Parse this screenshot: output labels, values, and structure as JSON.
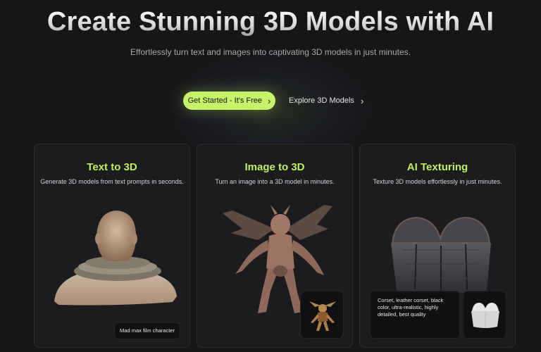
{
  "hero": {
    "title": "Create Stunning 3D Models with AI",
    "subtitle": "Effortlessly turn text and images into captivating 3D models in just minutes."
  },
  "cta": {
    "primary_label": "Get Started - It's Free",
    "secondary_label": "Explore 3D Models",
    "primary_color": "#c6f36a"
  },
  "features": [
    {
      "title": "Text to 3D",
      "description": "Generate 3D models from text prompts in seconds.",
      "prompt": "Mad max film character",
      "icon": "bust-model-image"
    },
    {
      "title": "Image to 3D",
      "description": "Turn an image into a 3D model in minutes.",
      "icon": "creature-model-image",
      "thumbnail_icon": "creature-thumbnail-image"
    },
    {
      "title": "AI Texturing",
      "description": "Texture 3D models effortlessly in just minutes.",
      "prompt": "Corset, leather corset, black color, ultra-realistic, highly detailed, best quality",
      "icon": "corset-model-image",
      "thumbnail_icon": "untextured-corset-thumbnail-image"
    }
  ],
  "colors": {
    "background": "#161618",
    "card": "#1c1c1f",
    "accent": "#bdf05c"
  }
}
